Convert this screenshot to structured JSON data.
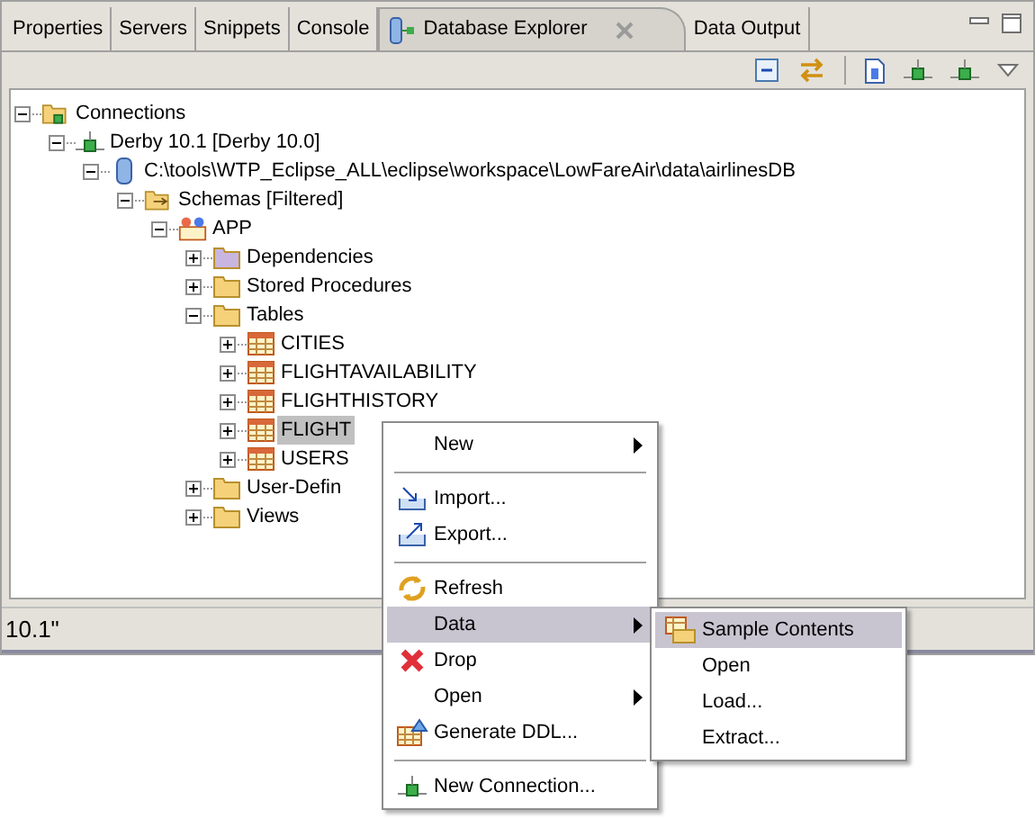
{
  "tabs": [
    {
      "label": "Properties",
      "selected": false,
      "closable": false
    },
    {
      "label": "Servers",
      "selected": false,
      "closable": false
    },
    {
      "label": "Snippets",
      "selected": false,
      "closable": false
    },
    {
      "label": "Console",
      "selected": false,
      "closable": false
    },
    {
      "label": "Database Explorer",
      "selected": true,
      "closable": true
    },
    {
      "label": "Data Output",
      "selected": false,
      "closable": false
    }
  ],
  "tree": {
    "items": [
      {
        "label": "Connections",
        "kind": "connections",
        "expanded": true,
        "selected": false,
        "children": [
          {
            "label": "Derby 10.1 [Derby 10.0]",
            "kind": "connection",
            "expanded": true,
            "selected": false,
            "children": [
              {
                "label": "C:\\tools\\WTP_Eclipse_ALL\\eclipse\\workspace\\LowFareAir\\data\\airlinesDB",
                "kind": "database",
                "expanded": true,
                "selected": false,
                "children": [
                  {
                    "label": "Schemas [Filtered]",
                    "kind": "schemas",
                    "expanded": true,
                    "selected": false,
                    "children": [
                      {
                        "label": "APP",
                        "kind": "schema",
                        "expanded": true,
                        "selected": false,
                        "children": [
                          {
                            "label": "Dependencies",
                            "kind": "dependencies",
                            "expanded": false,
                            "selected": false
                          },
                          {
                            "label": "Stored Procedures",
                            "kind": "folder",
                            "expanded": false,
                            "selected": false
                          },
                          {
                            "label": "Tables",
                            "kind": "folder",
                            "expanded": true,
                            "selected": false,
                            "children": [
                              {
                                "label": "CITIES",
                                "kind": "table",
                                "expanded": false,
                                "selected": false
                              },
                              {
                                "label": "FLIGHTAVAILABILITY",
                                "kind": "table",
                                "expanded": false,
                                "selected": false
                              },
                              {
                                "label": "FLIGHTHISTORY",
                                "kind": "table",
                                "expanded": false,
                                "selected": false
                              },
                              {
                                "label": "FLIGHT",
                                "kind": "table",
                                "expanded": false,
                                "selected": true
                              },
                              {
                                "label": "USERS",
                                "kind": "table",
                                "expanded": false,
                                "selected": false
                              }
                            ]
                          },
                          {
                            "label": "User-Defin",
                            "kind": "folder",
                            "expanded": false,
                            "selected": false
                          },
                          {
                            "label": "Views",
                            "kind": "folder",
                            "expanded": false,
                            "selected": false
                          }
                        ]
                      }
                    ]
                  }
                ]
              }
            ]
          }
        ]
      }
    ]
  },
  "status_bar": {
    "text": "10.1\""
  },
  "context_menu": {
    "items": [
      {
        "kind": "item",
        "label": "New",
        "submenu": true,
        "selected": false
      },
      {
        "kind": "separator"
      },
      {
        "kind": "item",
        "label": "Import...",
        "submenu": false,
        "selected": false
      },
      {
        "kind": "item",
        "label": "Export...",
        "submenu": false,
        "selected": false
      },
      {
        "kind": "separator"
      },
      {
        "kind": "item",
        "label": "Refresh",
        "submenu": false,
        "selected": false
      },
      {
        "kind": "item",
        "label": "Data",
        "submenu": true,
        "selected": true
      },
      {
        "kind": "item",
        "label": "Drop",
        "submenu": false,
        "selected": false
      },
      {
        "kind": "item",
        "label": "Open",
        "submenu": true,
        "selected": false
      },
      {
        "kind": "item",
        "label": "Generate DDL...",
        "submenu": false,
        "selected": false
      },
      {
        "kind": "separator"
      },
      {
        "kind": "item",
        "label": "New Connection...",
        "submenu": false,
        "selected": false
      }
    ]
  },
  "submenu": {
    "items": [
      {
        "kind": "item",
        "label": "Sample Contents",
        "submenu": false,
        "selected": true
      },
      {
        "kind": "item",
        "label": "Open",
        "submenu": false,
        "selected": false
      },
      {
        "kind": "item",
        "label": "Load...",
        "submenu": false,
        "selected": false
      },
      {
        "kind": "item",
        "label": "Extract...",
        "submenu": false,
        "selected": false
      }
    ]
  }
}
